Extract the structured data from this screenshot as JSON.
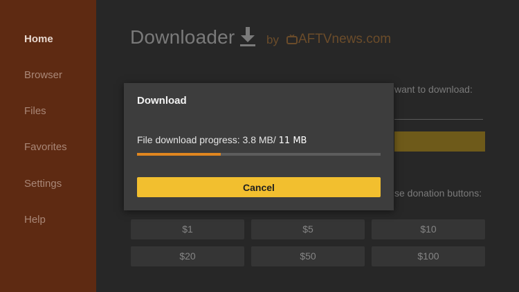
{
  "sidebar": {
    "items": [
      {
        "label": "Home",
        "active": true
      },
      {
        "label": "Browser"
      },
      {
        "label": "Files"
      },
      {
        "label": "Favorites"
      },
      {
        "label": "Settings"
      },
      {
        "label": "Help"
      }
    ]
  },
  "header": {
    "title": "Downloader",
    "by": "by",
    "brand": "AFTVnews.com",
    "icon": "download-icon",
    "brand_icon": "tv-icon"
  },
  "background": {
    "url_prompt": "want to download:",
    "donation_prompt": "se donation buttons:",
    "donation_buttons": [
      "$1",
      "$5",
      "$10",
      "$20",
      "$50",
      "$100"
    ]
  },
  "dialog": {
    "title": "Download",
    "progress_label": "File download progress: 3.8 MB/",
    "progress_total": "11 MB",
    "progress_fraction": 0.345,
    "cancel_label": "Cancel"
  },
  "colors": {
    "sidebar": "#5e2a12",
    "accent": "#f2bf2f",
    "progress": "#e0861f"
  }
}
